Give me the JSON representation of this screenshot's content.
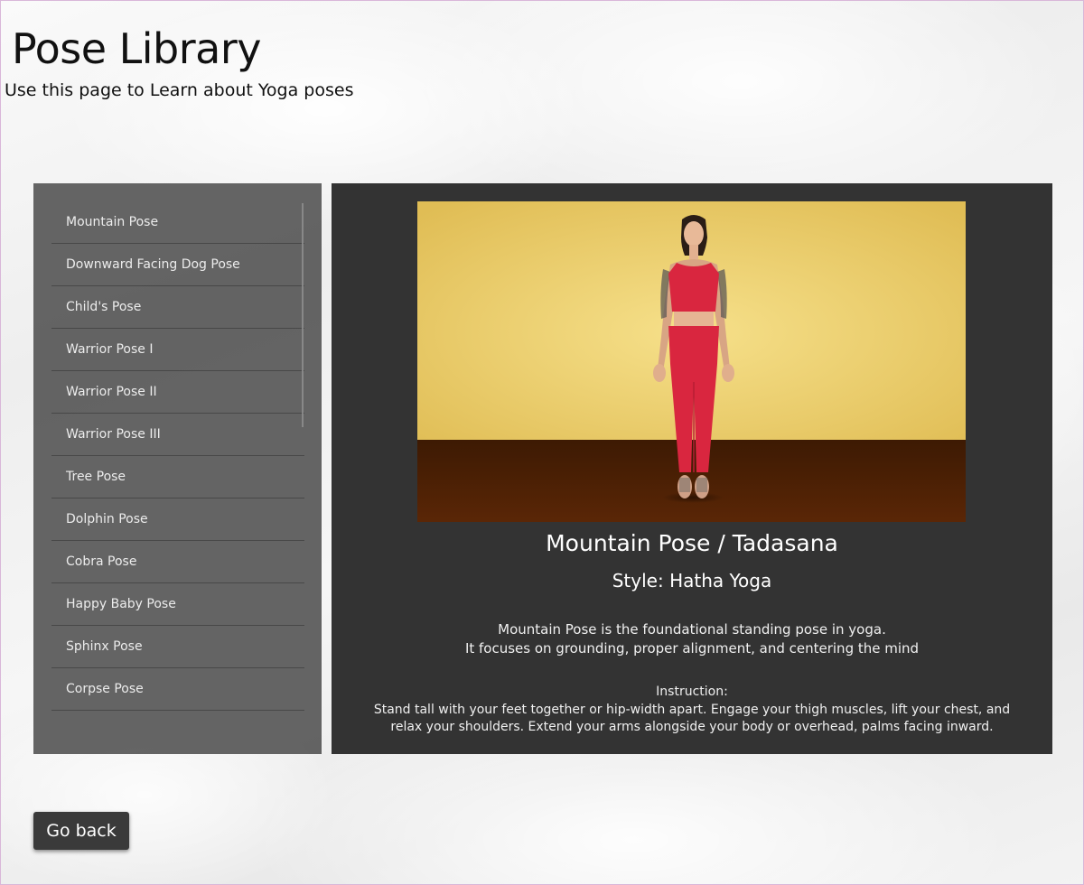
{
  "header": {
    "title": "Pose Library",
    "subtitle": "Use this page to Learn about Yoga poses"
  },
  "sidebar": {
    "items": [
      {
        "label": "Mountain Pose"
      },
      {
        "label": "Downward Facing Dog Pose"
      },
      {
        "label": "Child's Pose"
      },
      {
        "label": "Warrior Pose I"
      },
      {
        "label": "Warrior Pose II"
      },
      {
        "label": "Warrior Pose III"
      },
      {
        "label": "Tree Pose"
      },
      {
        "label": "Dolphin Pose"
      },
      {
        "label": "Cobra Pose"
      },
      {
        "label": "Happy Baby Pose"
      },
      {
        "label": "Sphinx Pose"
      },
      {
        "label": "Corpse Pose"
      }
    ]
  },
  "pose": {
    "title": "Mountain Pose / Tadasana",
    "style": "Style: Hatha Yoga",
    "description_line1": "Mountain Pose is the foundational standing pose in yoga.",
    "description_line2": "It focuses on grounding, proper alignment, and centering the mind",
    "instruction_heading": "Instruction:",
    "instruction_text": "Stand tall with your feet together or hip-width apart. Engage your thigh muscles, lift your chest, and relax your shoulders. Extend your arms alongside your body or overhead, palms facing inward."
  },
  "footer": {
    "go_back_label": "Go back"
  },
  "colors": {
    "panel_bg": "#333333",
    "sidebar_bg": "#505050",
    "wall": "#f0d574",
    "floor": "#4a1f04",
    "outfit": "#d9263f"
  }
}
